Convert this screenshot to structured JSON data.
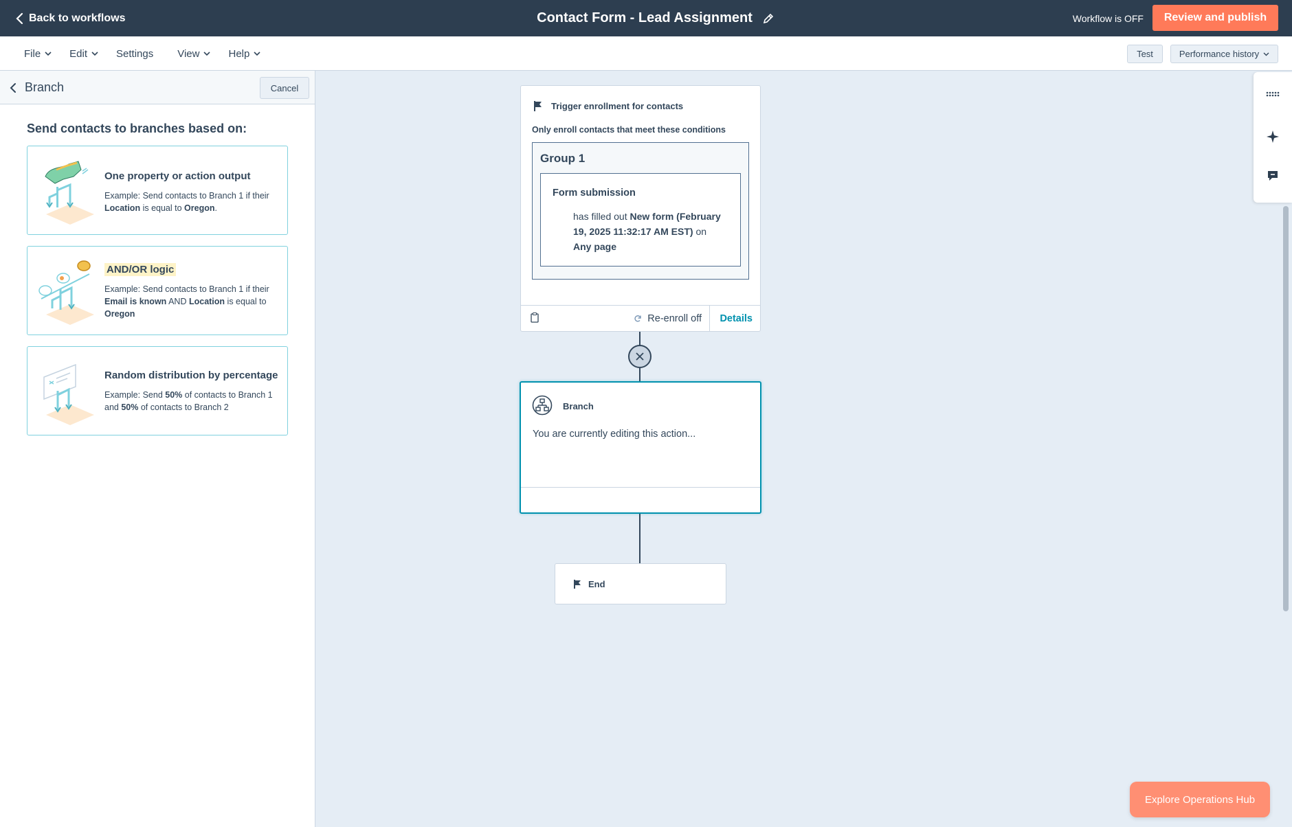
{
  "topbar": {
    "back_label": "Back to workflows",
    "workflow_title": "Contact Form - Lead Assignment",
    "workflow_status": "Workflow is OFF",
    "publish_label": "Review and publish"
  },
  "menubar": {
    "items": [
      {
        "label": "File",
        "dropdown": true
      },
      {
        "label": "Edit",
        "dropdown": true
      },
      {
        "label": "Settings",
        "dropdown": false
      },
      {
        "label": "View",
        "dropdown": true
      },
      {
        "label": "Help",
        "dropdown": true
      }
    ],
    "test_label": "Test",
    "performance_label": "Performance history"
  },
  "panel": {
    "header_title": "Branch",
    "cancel_label": "Cancel",
    "heading": "Send contacts to branches based on:",
    "options": [
      {
        "title": "One property or action output",
        "desc_parts": [
          "Example: Send contacts to Branch 1 if their ",
          "Location",
          " is equal to ",
          "Oregon",
          "."
        ]
      },
      {
        "title": "AND/OR logic",
        "desc_parts": [
          "Example: Send contacts to Branch 1 if their ",
          "Email is known",
          " AND ",
          "Location",
          " is equal to ",
          "Oregon"
        ]
      },
      {
        "title": "Random distribution by percentage",
        "desc_parts": [
          "Example: Send ",
          "50%",
          " of contacts to Branch 1 and ",
          "50%",
          " of contacts to Branch 2"
        ]
      }
    ]
  },
  "trigger": {
    "title": "Trigger enrollment for contacts",
    "subtitle": "Only enroll contacts that meet these conditions",
    "group_title": "Group 1",
    "filter_title": "Form submission",
    "filter_desc_parts": [
      "has filled out ",
      "New form (February 19, 2025 11:32:17 AM EST)",
      " on ",
      "Any page"
    ],
    "reenroll_label": "Re-enroll off",
    "details_label": "Details"
  },
  "branch_action": {
    "title": "Branch",
    "message": "You are currently editing this action..."
  },
  "end_node": {
    "label": "End"
  },
  "explore_label": "Explore Operations Hub",
  "colors": {
    "topbar": "#2d3e50",
    "primary_orange": "#ff7a59",
    "accent_teal": "#0091ae",
    "canvas_bg": "#e5edf5"
  }
}
